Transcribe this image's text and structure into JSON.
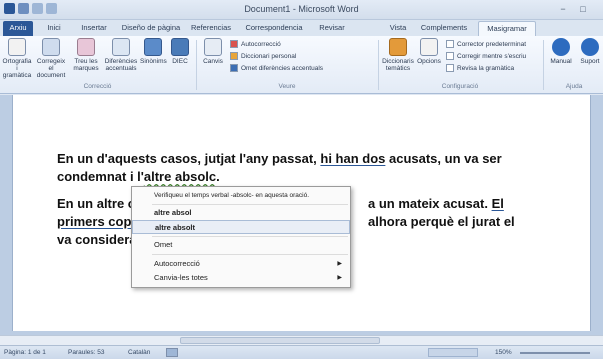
{
  "window": {
    "title": "Document1 - Microsoft Word",
    "minimize": "−",
    "maximize": "□"
  },
  "tabs": [
    "Arxiu",
    "Inici",
    "Insertar",
    "Diseño de pàgina",
    "Referencias",
    "Correspondencia",
    "Revisar",
    "Vista",
    "Complements",
    "Masigramar"
  ],
  "ribbon": {
    "correccio": {
      "buttons": [
        "Ortografia i gramàtica",
        "Corregeix el document",
        "Treu les marques",
        "Diferències accentuals",
        "Sinònims",
        "DIEC"
      ],
      "label": "Correcció"
    },
    "veure": {
      "canvis": "Canvis",
      "options": [
        "Autocorrecció",
        "Diccionari personal",
        "Omet diferències accentuals"
      ],
      "label": "Veure"
    },
    "configuracio": {
      "buttons": [
        "Diccionaris temàtics",
        "Opcions"
      ],
      "checks": [
        "Corrector predeterminat",
        "Corregir mentre s'escriu",
        "Revisa la gramàtica"
      ],
      "label": "Configuració"
    },
    "ajuda": {
      "buttons": [
        "Manual",
        "Suport"
      ],
      "label": "Ajuda"
    },
    "colors": {
      "accent": "#2b5797",
      "red": "#d9534f",
      "orange": "#e8a53a",
      "blue": "#3c6eb4"
    }
  },
  "document": {
    "p1_l1_a": "En un d'aquests casos, jutjat l'any passat, ",
    "p1_l1_b": "hi han dos",
    "p1_l1_c": " acusats,  un va ser",
    "p1_l2_a": "condemnat i l'",
    "p1_l2_b": "altre absolc",
    "p1_l2_c": ".",
    "p2_l1_a": "En un altre ca",
    "p2_l1_b": "a un mateix acusat. ",
    "p2_l1_c": "El",
    "p2_l2_a": "primers cop",
    "p2_l2_b": " l'",
    "p2_l2_c": "alhora perquè el jurat el",
    "p3_l1_a": "va considerar"
  },
  "context_menu": {
    "header": "Verifiqueu el temps verbal -absolc- en aquesta oració.",
    "items": [
      "altre absol",
      "altre absolt",
      "Omet",
      "Autocorrecció",
      "Canvia-les totes"
    ]
  },
  "status": {
    "page": "Pàgina: 1 de 1",
    "words": "Paraules: 53",
    "language": "Catalàn",
    "zoom": "150%"
  }
}
